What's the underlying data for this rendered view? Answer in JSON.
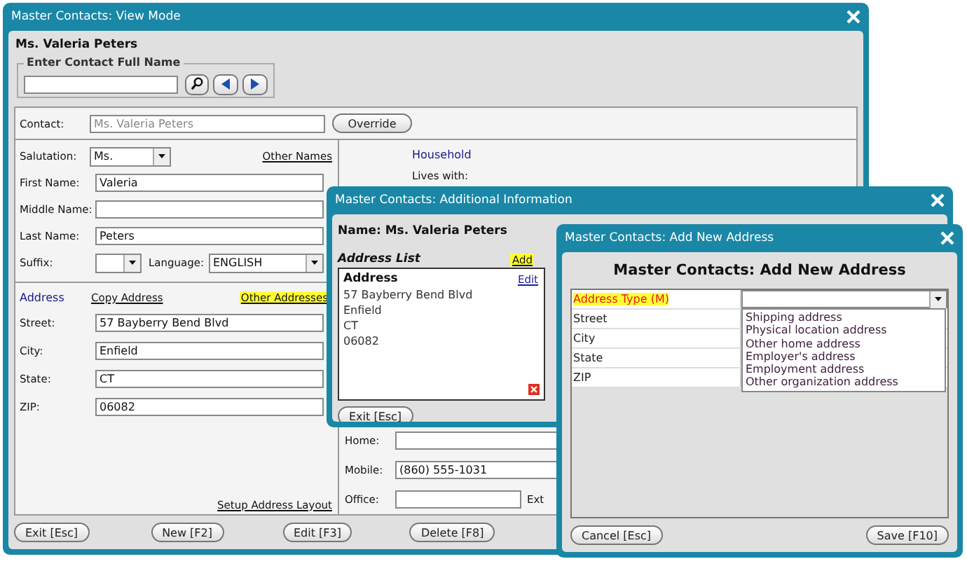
{
  "main_window": {
    "title": "Master Contacts: View Mode",
    "heading": "Ms. Valeria Peters",
    "search": {
      "legend": "Enter Contact Full Name"
    },
    "contact": {
      "label": "Contact:",
      "value": "Ms. Valeria Peters",
      "disabled": true,
      "button": "Override"
    },
    "salutation": {
      "label": "Salutation:",
      "value": "Ms."
    },
    "other_names_link": {
      "text": "Other Names",
      "highlighted": false
    },
    "name_fields": [
      {
        "label": "First Name:",
        "value": "Valeria"
      },
      {
        "label": "Middle Name:"
      },
      {
        "label": "Last Name:",
        "value": "Peters"
      }
    ],
    "suffix": {
      "label": "Suffix:"
    },
    "language": {
      "label": "Language:",
      "value": "ENGLISH"
    },
    "address": {
      "heading": "Address",
      "links": [
        {
          "text": "Copy Address",
          "highlighted": false
        },
        {
          "text": "Other Addresses",
          "highlighted": true
        }
      ],
      "fields": [
        {
          "label": "Street:",
          "value": "57 Bayberry Bend Blvd"
        },
        {
          "label": "City:",
          "value": "Enfield"
        },
        {
          "label": "State:",
          "value": "CT"
        },
        {
          "label": "ZIP:",
          "value": "06082"
        }
      ],
      "layout_link": "Setup Address Layout"
    },
    "household": {
      "heading": "Household",
      "lives_with": "Lives with:"
    },
    "phones": [
      {
        "label": "Home:"
      },
      {
        "label": "Mobile:",
        "value": "(860) 555-1031"
      },
      {
        "label": "Office:",
        "extension_label": "Ext"
      }
    ],
    "buttons": [
      "Exit [Esc]",
      "New [F2]",
      "Edit [F3]",
      "Delete [F8]"
    ]
  },
  "additional_window": {
    "title": "Master Contacts: Additional Information",
    "name_line": "Name: Ms. Valeria Peters",
    "address_list": {
      "title": "Address List",
      "add_link": {
        "text": "Add",
        "highlighted": true
      },
      "entries": [
        {
          "heading": "Address",
          "edit_link": "Edit",
          "lines": [
            "57 Bayberry Bend Blvd",
            "Enfield",
            "CT",
            "06082"
          ]
        }
      ]
    },
    "exit_button": "Exit [Esc]"
  },
  "add_window": {
    "title": "Master Contacts: Add New Address",
    "heading": "Master Contacts: Add New Address",
    "rows": [
      {
        "label": "Address Type (M)",
        "required": true,
        "highlighted": true,
        "kind": "select",
        "expanded": true,
        "options": [
          "Shipping address",
          "Physical location address",
          "Other home address",
          "Employer's address",
          "Employment address",
          "Other organization address"
        ]
      },
      {
        "label": "Street",
        "required": false,
        "highlighted": false,
        "kind": "text"
      },
      {
        "label": "City",
        "required": false,
        "highlighted": false,
        "kind": "text"
      },
      {
        "label": "State",
        "required": false,
        "highlighted": false,
        "kind": "text"
      },
      {
        "label": "ZIP",
        "required": false,
        "highlighted": false,
        "kind": "text"
      }
    ],
    "buttons": [
      "Cancel [Esc]",
      "Save [F10]"
    ]
  }
}
